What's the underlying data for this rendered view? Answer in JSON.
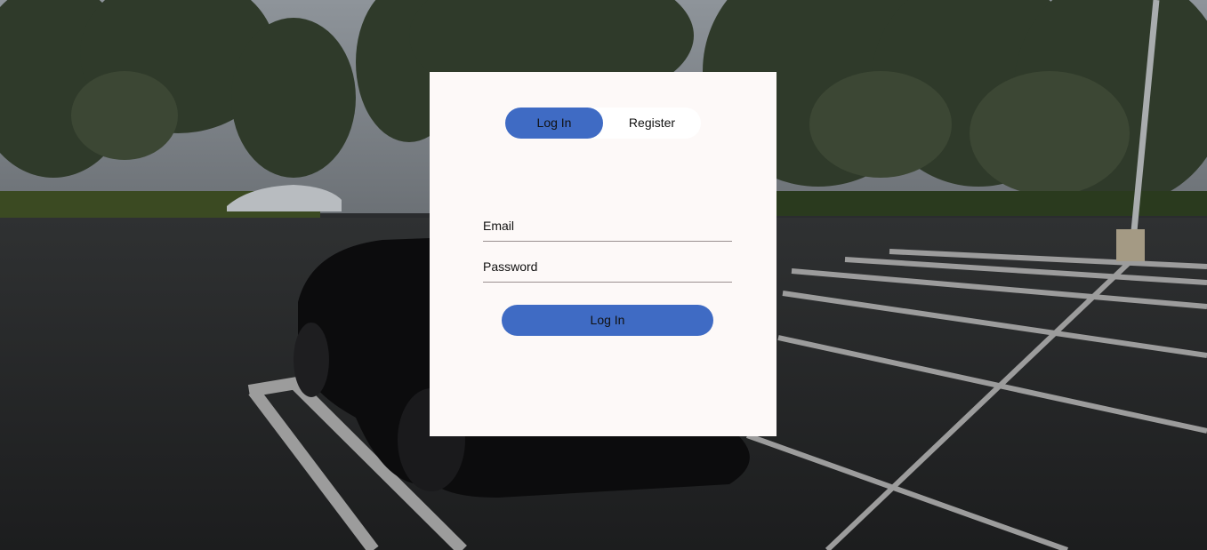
{
  "colors": {
    "accent": "#3f6bc4",
    "card_background": "#fdf9f8",
    "toggle_background": "#ffffff"
  },
  "background": {
    "description_icon": "parking-lot-with-black-sports-car-photo"
  },
  "tabs": {
    "login_label": "Log In",
    "register_label": "Register",
    "active": "Log In"
  },
  "form": {
    "email": {
      "placeholder": "Email",
      "value": ""
    },
    "password": {
      "placeholder": "Password",
      "value": ""
    },
    "submit_label": "Log In"
  }
}
